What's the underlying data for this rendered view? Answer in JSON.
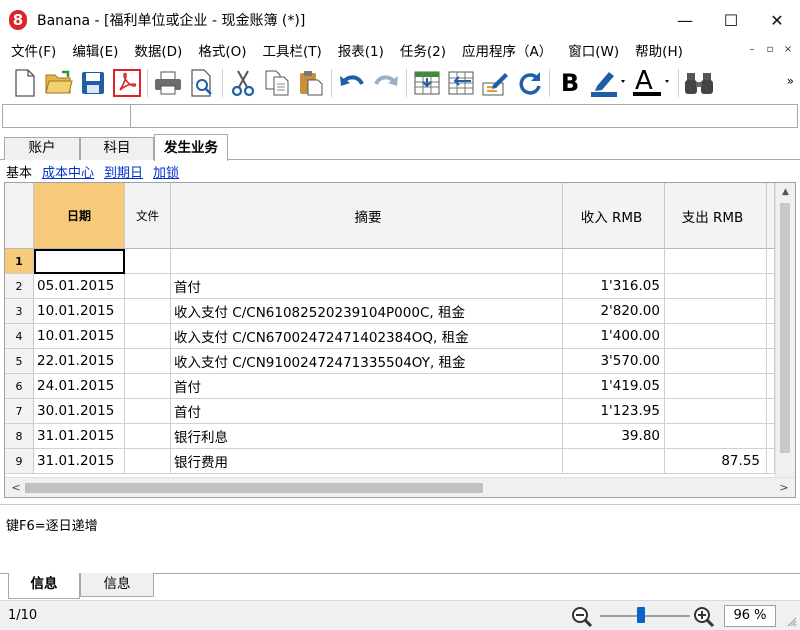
{
  "window": {
    "title": "Banana - [福利单位或企业 - 现金账簿 (*)]",
    "logo_digit": "8",
    "minimize_glyph": "—",
    "maximize_glyph": "☐",
    "close_glyph": "✕"
  },
  "menu": [
    "文件(F)",
    "编辑(E)",
    "数据(D)",
    "格式(O)",
    "工具栏(T)",
    "报表(1)",
    "任务(2)",
    "应用程序（A）",
    "窗口(W)",
    "帮助(H)"
  ],
  "mdi_controls": [
    "–",
    "▫",
    "×"
  ],
  "toolbar": {
    "icons": [
      "new-file-icon",
      "open-folder-icon",
      "save-icon",
      "pdf-icon",
      "print-icon",
      "print-preview-icon",
      "cut-icon",
      "copy-icon",
      "paste-icon",
      "undo-icon",
      "redo-icon",
      "add-rows-icon",
      "delete-rows-icon",
      "edit-icon",
      "refresh-icon",
      "bold-icon",
      "highlighter-icon",
      "font-color-icon",
      "binoculars-icon"
    ],
    "bold_label": "B",
    "font_color_label": "A",
    "more_glyph": "»"
  },
  "input_bar": {
    "cell_ref": "",
    "value": ""
  },
  "tabs": [
    "账户",
    "科目",
    "发生业务"
  ],
  "views": [
    "基本",
    "成本中心",
    "到期日",
    "加锁"
  ],
  "grid": {
    "columns": {
      "rownum": "",
      "date": "日期",
      "doc": "文件",
      "desc": "摘要",
      "income": "收入 RMB",
      "expense": "支出 RMB"
    },
    "rows": [
      {
        "n": "1",
        "date": "",
        "doc": "",
        "desc": "",
        "income": "",
        "expense": ""
      },
      {
        "n": "2",
        "date": "05.01.2015",
        "doc": "",
        "desc": "首付",
        "income": "1'316.05",
        "expense": ""
      },
      {
        "n": "3",
        "date": "10.01.2015",
        "doc": "",
        "desc": "收入支付 C/CN61082520239104P000C, 租金",
        "income": "2'820.00",
        "expense": ""
      },
      {
        "n": "4",
        "date": "10.01.2015",
        "doc": "",
        "desc": "收入支付 C/CN67002472471402384OQ, 租金",
        "income": "1'400.00",
        "expense": ""
      },
      {
        "n": "5",
        "date": "22.01.2015",
        "doc": "",
        "desc": "收入支付 C/CN91002472471335504OY, 租金",
        "income": "3'570.00",
        "expense": ""
      },
      {
        "n": "6",
        "date": "24.01.2015",
        "doc": "",
        "desc": "首付",
        "income": "1'419.05",
        "expense": ""
      },
      {
        "n": "7",
        "date": "30.01.2015",
        "doc": "",
        "desc": "首付",
        "income": "1'123.95",
        "expense": ""
      },
      {
        "n": "8",
        "date": "31.01.2015",
        "doc": "",
        "desc": "银行利息",
        "income": "39.80",
        "expense": ""
      },
      {
        "n": "9",
        "date": "31.01.2015",
        "doc": "",
        "desc": "银行费用",
        "income": "",
        "expense": "87.55"
      }
    ]
  },
  "info": {
    "message": "键F6=逐日递增",
    "tabs": [
      "信息",
      "信息"
    ]
  },
  "status": {
    "position": "1/10",
    "zoom": "96  %",
    "zoom_level": 0.46
  },
  "colors": {
    "selected_header": "#f7c97a",
    "link": "#0033cc",
    "accent_blue": "#0a64c8",
    "pdf_red": "#d9252a"
  }
}
